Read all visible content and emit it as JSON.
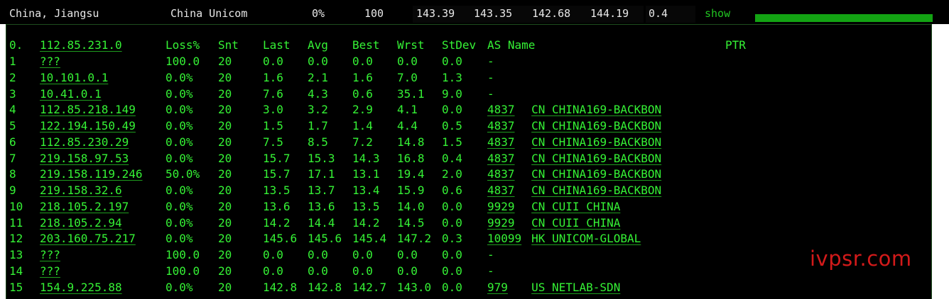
{
  "summary": {
    "location": "China, Jiangsu",
    "isp": "China Unicom",
    "loss": "0%",
    "sent": "100",
    "last": "143.39",
    "avg": "143.35",
    "best": "142.68",
    "worst": "144.19",
    "stdev": "0.4",
    "show_label": "show",
    "progress": 1.0
  },
  "table": {
    "headers": {
      "hop": "0.",
      "host": "112.85.231.0",
      "loss": "Loss%",
      "snt": "Snt",
      "last": "Last",
      "avg": "Avg",
      "best": "Best",
      "wrst": "Wrst",
      "stdev": "StDev",
      "as_name": "AS Name",
      "ptr": "PTR"
    },
    "rows": [
      {
        "hop": "1",
        "host": "???",
        "loss": "100.0",
        "snt": "20",
        "last": "0.0",
        "avg": "0.0",
        "best": "0.0",
        "wrst": "0.0",
        "stdev": "0.0",
        "asn": "-",
        "as_name": ""
      },
      {
        "hop": "2",
        "host": "10.101.0.1",
        "loss": "0.0%",
        "snt": "20",
        "last": "1.6",
        "avg": "2.1",
        "best": "1.6",
        "wrst": "7.0",
        "stdev": "1.3",
        "asn": "-",
        "as_name": ""
      },
      {
        "hop": "3",
        "host": "10.41.0.1",
        "loss": "0.0%",
        "snt": "20",
        "last": "7.6",
        "avg": "4.3",
        "best": "0.6",
        "wrst": "35.1",
        "stdev": "9.0",
        "asn": "-",
        "as_name": ""
      },
      {
        "hop": "4",
        "host": "112.85.218.149",
        "loss": "0.0%",
        "snt": "20",
        "last": "3.0",
        "avg": "3.2",
        "best": "2.9",
        "wrst": "4.1",
        "stdev": "0.0",
        "asn": "4837",
        "as_name": "CN CHINA169-BACKBON"
      },
      {
        "hop": "5",
        "host": "122.194.150.49",
        "loss": "0.0%",
        "snt": "20",
        "last": "1.5",
        "avg": "1.7",
        "best": "1.4",
        "wrst": "4.4",
        "stdev": "0.5",
        "asn": "4837",
        "as_name": "CN CHINA169-BACKBON"
      },
      {
        "hop": "6",
        "host": "112.85.230.29",
        "loss": "0.0%",
        "snt": "20",
        "last": "7.5",
        "avg": "8.5",
        "best": "7.2",
        "wrst": "14.8",
        "stdev": "1.5",
        "asn": "4837",
        "as_name": "CN CHINA169-BACKBON"
      },
      {
        "hop": "7",
        "host": "219.158.97.53",
        "loss": "0.0%",
        "snt": "20",
        "last": "15.7",
        "avg": "15.3",
        "best": "14.3",
        "wrst": "16.8",
        "stdev": "0.4",
        "asn": "4837",
        "as_name": "CN CHINA169-BACKBON"
      },
      {
        "hop": "8",
        "host": "219.158.119.246",
        "loss": "50.0%",
        "snt": "20",
        "last": "15.7",
        "avg": "17.1",
        "best": "13.1",
        "wrst": "19.4",
        "stdev": "2.0",
        "asn": "4837",
        "as_name": "CN CHINA169-BACKBON"
      },
      {
        "hop": "9",
        "host": "219.158.32.6",
        "loss": "0.0%",
        "snt": "20",
        "last": "13.5",
        "avg": "13.7",
        "best": "13.4",
        "wrst": "15.9",
        "stdev": "0.6",
        "asn": "4837",
        "as_name": "CN CHINA169-BACKBON"
      },
      {
        "hop": "10",
        "host": "218.105.2.197",
        "loss": "0.0%",
        "snt": "20",
        "last": "13.6",
        "avg": "13.6",
        "best": "13.5",
        "wrst": "14.0",
        "stdev": "0.0",
        "asn": "9929",
        "as_name": "CN CUII CHINA"
      },
      {
        "hop": "11",
        "host": "218.105.2.94",
        "loss": "0.0%",
        "snt": "20",
        "last": "14.2",
        "avg": "14.4",
        "best": "14.2",
        "wrst": "14.5",
        "stdev": "0.0",
        "asn": "9929",
        "as_name": "CN CUII CHINA"
      },
      {
        "hop": "12",
        "host": "203.160.75.217",
        "loss": "0.0%",
        "snt": "20",
        "last": "145.6",
        "avg": "145.6",
        "best": "145.4",
        "wrst": "147.2",
        "stdev": "0.3",
        "asn": "10099",
        "as_name": "HK UNICOM-GLOBAL"
      },
      {
        "hop": "13",
        "host": "???",
        "loss": "100.0",
        "snt": "20",
        "last": "0.0",
        "avg": "0.0",
        "best": "0.0",
        "wrst": "0.0",
        "stdev": "0.0",
        "asn": "-",
        "as_name": ""
      },
      {
        "hop": "14",
        "host": "???",
        "loss": "100.0",
        "snt": "20",
        "last": "0.0",
        "avg": "0.0",
        "best": "0.0",
        "wrst": "0.0",
        "stdev": "0.0",
        "asn": "-",
        "as_name": ""
      },
      {
        "hop": "15",
        "host": "154.9.225.88",
        "loss": "0.0%",
        "snt": "20",
        "last": "142.8",
        "avg": "142.8",
        "best": "142.7",
        "wrst": "143.0",
        "stdev": "0.0",
        "asn": "979",
        "as_name": "US NETLAB-SDN"
      }
    ]
  },
  "watermark": "ivpsr.com",
  "colors": {
    "terminal_bg": "#000000",
    "text_green": "#35f235",
    "progress_green": "#13a313",
    "watermark_red": "#d21a1a"
  }
}
